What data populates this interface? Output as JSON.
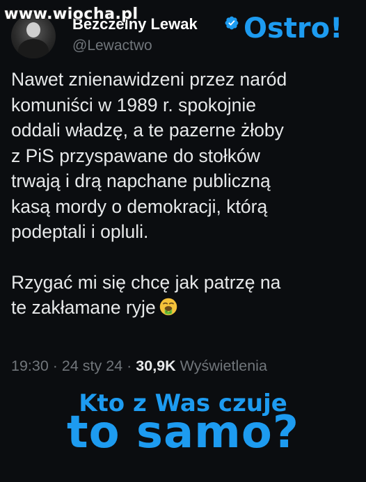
{
  "watermark": "www.wiocha.pl",
  "overlay_top": "Ostro!",
  "author": {
    "display_name": "Bezczelny Lewak",
    "handle": "@Lewactwo",
    "verified_icon": "verified-badge-icon"
  },
  "tweet": {
    "paragraph1": "Nawet znienawidzeni przez naród\nkomuniści w 1989 r. spokojnie\noddali władzę, a te pazerne żłoby\nz PiS przyspawane do stołków\ntrwają i drą napchane publiczną\nkasą mordy o demokracji, którą\npodeptali i opluli.",
    "paragraph2": "Rzygać mi się chcę jak patrzę na\nte zakłamane ryje",
    "emoji": "vomiting-face-icon"
  },
  "meta": {
    "time": "19:30",
    "separator": " · ",
    "date": "24 sty 24",
    "views_count": "30,9K",
    "views_label": "Wyświetlenia"
  },
  "overlay_bottom": {
    "line1": "Kto z Was czuje",
    "line2": "to samo?"
  },
  "colors": {
    "accent": "#1d9bf0",
    "background": "#0b0d10",
    "text": "#e7e9ea",
    "muted": "#71767b"
  }
}
